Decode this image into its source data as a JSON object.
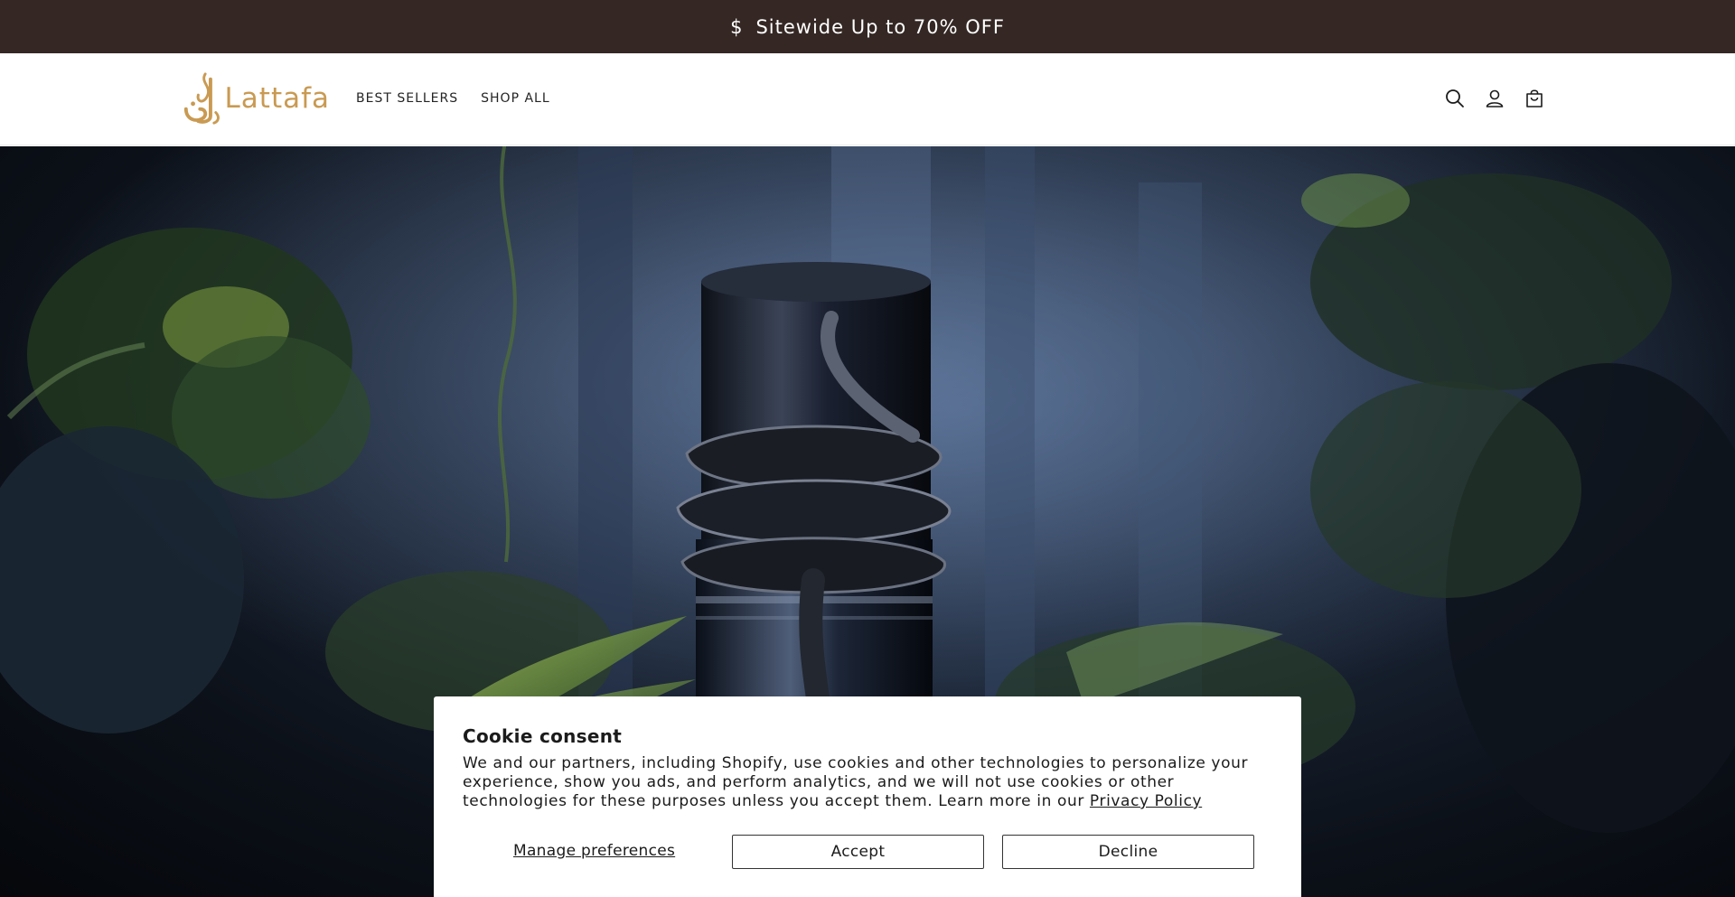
{
  "announcement": {
    "icon": "dollar-icon",
    "symbol": "$",
    "text": "Sitewide Up to 70% OFF",
    "background": "#352824"
  },
  "header": {
    "logo_text": "Lattafa",
    "brand_color": "#c99a52",
    "nav": [
      {
        "label": "BEST SELLERS"
      },
      {
        "label": "SHOP ALL"
      }
    ],
    "icons": [
      "search-icon",
      "account-icon",
      "cart-icon"
    ]
  },
  "hero": {
    "alt": "Black perfume bottle wrapped by a serpent in a dark jungle"
  },
  "cookie": {
    "title": "Cookie consent",
    "body": "We and our partners, including Shopify, use cookies and other technologies to personalize your experience, show you ads, and perform analytics, and we will not use cookies or other technologies for these purposes unless you accept them. Learn more in our ",
    "privacy_link": "Privacy Policy",
    "manage_label": "Manage preferences",
    "accept_label": "Accept",
    "decline_label": "Decline"
  }
}
